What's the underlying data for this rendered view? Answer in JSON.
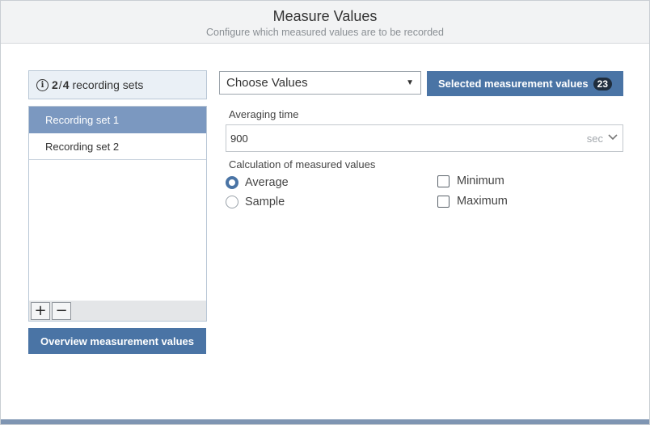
{
  "header": {
    "title": "Measure Values",
    "subtitle": "Configure which measured values are to be recorded"
  },
  "recording_sets": {
    "current": "2",
    "separator": "/",
    "max": "4",
    "label": "recording sets",
    "items": [
      {
        "label": "Recording set 1",
        "selected": true
      },
      {
        "label": "Recording set 2",
        "selected": false
      }
    ],
    "add_symbol": "+",
    "remove_symbol": "−"
  },
  "overview_button": "Overview measurement values",
  "choose_values": {
    "value": "Choose Values",
    "caret": "▼"
  },
  "selected_button": {
    "label": "Selected measurement values",
    "count": "23"
  },
  "averaging": {
    "label": "Averaging time",
    "value": "900",
    "unit": "sec"
  },
  "calculation": {
    "label": "Calculation of measured values",
    "average": "Average",
    "sample": "Sample",
    "minimum": "Minimum",
    "maximum": "Maximum",
    "selected_radio": "average"
  },
  "colors": {
    "accent": "#4a74a5",
    "selected_row": "#7b98c0",
    "info_bg": "#eaf0f6"
  }
}
